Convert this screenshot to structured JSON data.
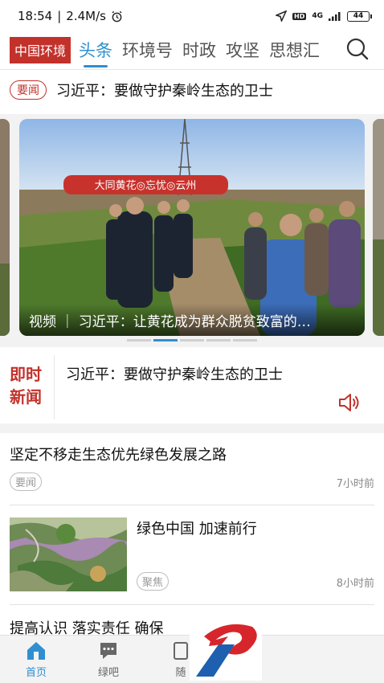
{
  "status_bar": {
    "time": "18:54",
    "speed": "2.4M/s",
    "network": "4G",
    "hd": "HD",
    "battery": "44"
  },
  "header": {
    "brand": "中国环境",
    "tabs": [
      "头条",
      "环境号",
      "时政",
      "攻坚",
      "思想汇"
    ],
    "active_tab": 0
  },
  "headline": {
    "badge": "要闻",
    "title": "习近平：要做守护秦岭生态的卫士"
  },
  "carousel": {
    "caption": "视频 ｜ 习近平：让黄花成为群众脱贫致富的…",
    "sign_text": "大同黄花◎忘忧◎云州",
    "dot_count": 5,
    "active_dot": 1
  },
  "live_news": {
    "label_line1": "即时",
    "label_line2": "新闻",
    "text": "习近平：要做守护秦岭生态的卫士"
  },
  "news": [
    {
      "title": "坚定不移走生态优先绿色发展之路",
      "tag": "要闻",
      "time": "7小时前"
    },
    {
      "title": "绿色中国  加速前行",
      "tag": "聚焦",
      "time": "8小时前"
    },
    {
      "title": "提高认识 落实责任 确保"
    }
  ],
  "bottom_nav": [
    {
      "label": "首页"
    },
    {
      "label": "绿吧"
    },
    {
      "label": "随"
    }
  ],
  "colors": {
    "brand_red": "#c3312b",
    "accent_blue": "#2f8fd0",
    "logo_red": "#d7262b",
    "logo_blue": "#1f5fb0"
  }
}
